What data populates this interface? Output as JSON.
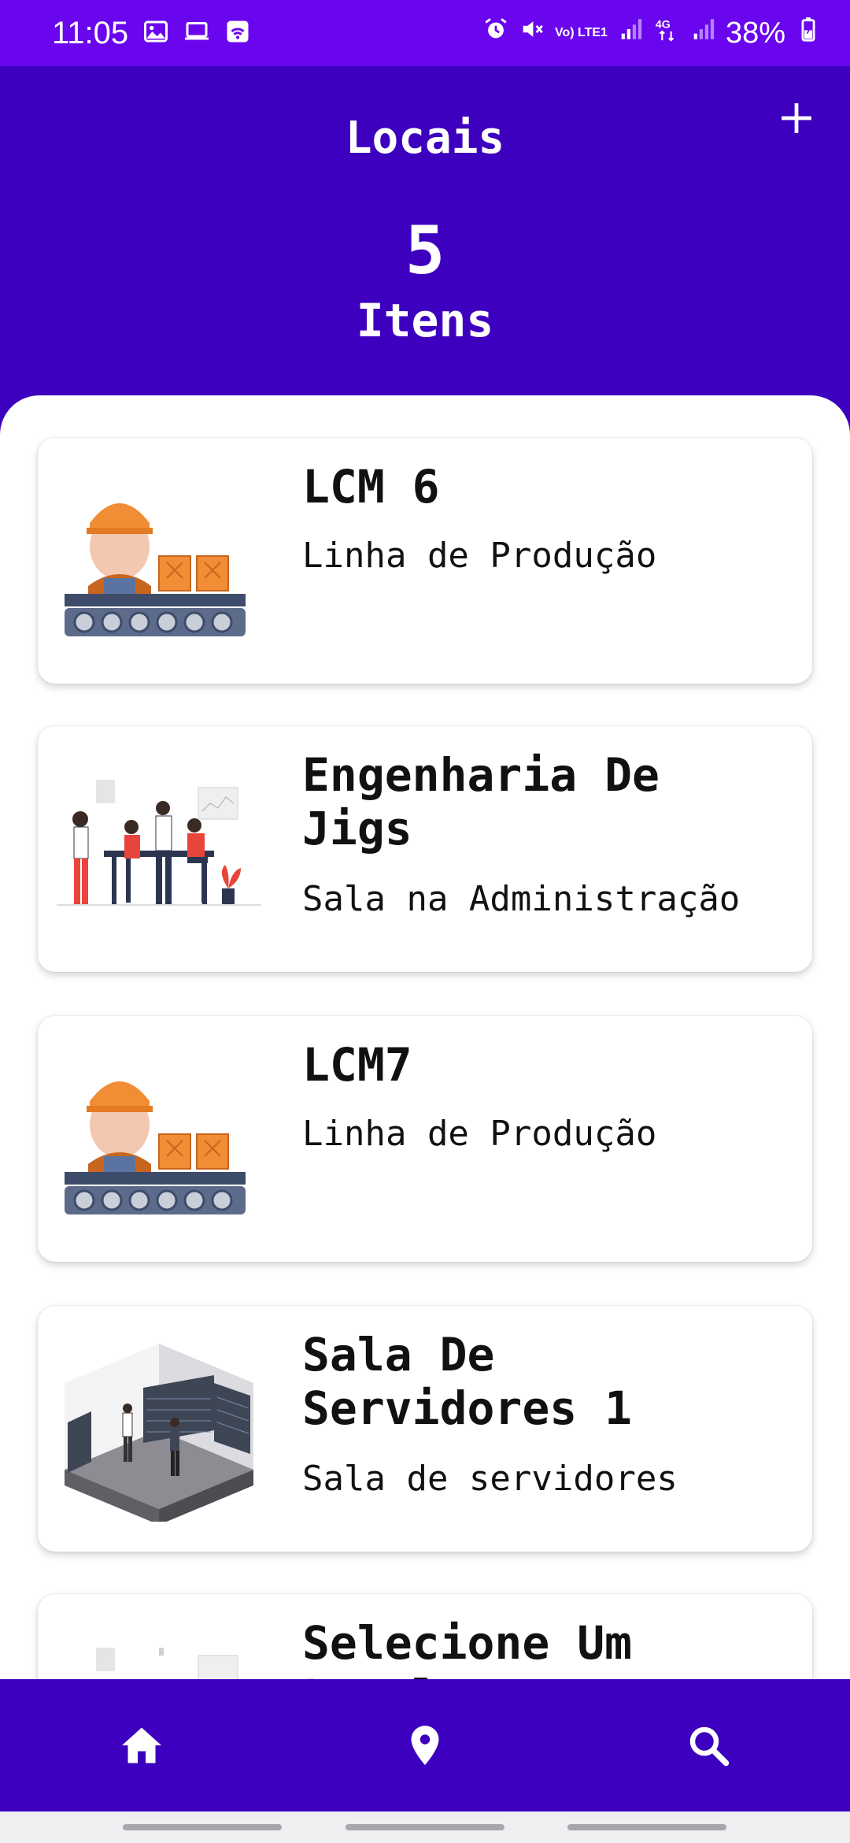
{
  "status_bar": {
    "time": "11:05",
    "battery": "38%",
    "network_label": "Vo) LTE1",
    "left_icons": [
      "image-icon",
      "laptop-icon",
      "wifi-calling-icon"
    ],
    "right_icons": [
      "alarm-icon",
      "mute-icon",
      "volte-icon",
      "signal-icon",
      "4g-icon",
      "signal-icon",
      "battery-icon"
    ]
  },
  "header": {
    "title": "Locais",
    "count": "5",
    "count_label": "Itens",
    "add_icon": "plus-icon"
  },
  "colors": {
    "header_bg": "#3d00bf",
    "status_bg": "#6a06ee",
    "card_bg": "#ffffff",
    "text": "#111111"
  },
  "items": [
    {
      "title": "LCM 6",
      "subtitle": "Linha de Produção",
      "thumbnail": "production-line-illustration"
    },
    {
      "title": "Engenharia De Jigs",
      "subtitle": "Sala na Administração",
      "thumbnail": "office-meeting-illustration"
    },
    {
      "title": "LCM7",
      "subtitle": "Linha de Produção",
      "thumbnail": "production-line-illustration"
    },
    {
      "title": "Sala De Servidores 1",
      "subtitle": "Sala de servidores",
      "thumbnail": "server-room-illustration"
    },
    {
      "title": "Selecione Um Local",
      "subtitle": "",
      "thumbnail": "office-meeting-illustration"
    }
  ],
  "bottom_nav": [
    {
      "name": "home",
      "icon": "home-icon"
    },
    {
      "name": "locations",
      "icon": "location-pin-icon"
    },
    {
      "name": "search",
      "icon": "search-icon"
    }
  ]
}
